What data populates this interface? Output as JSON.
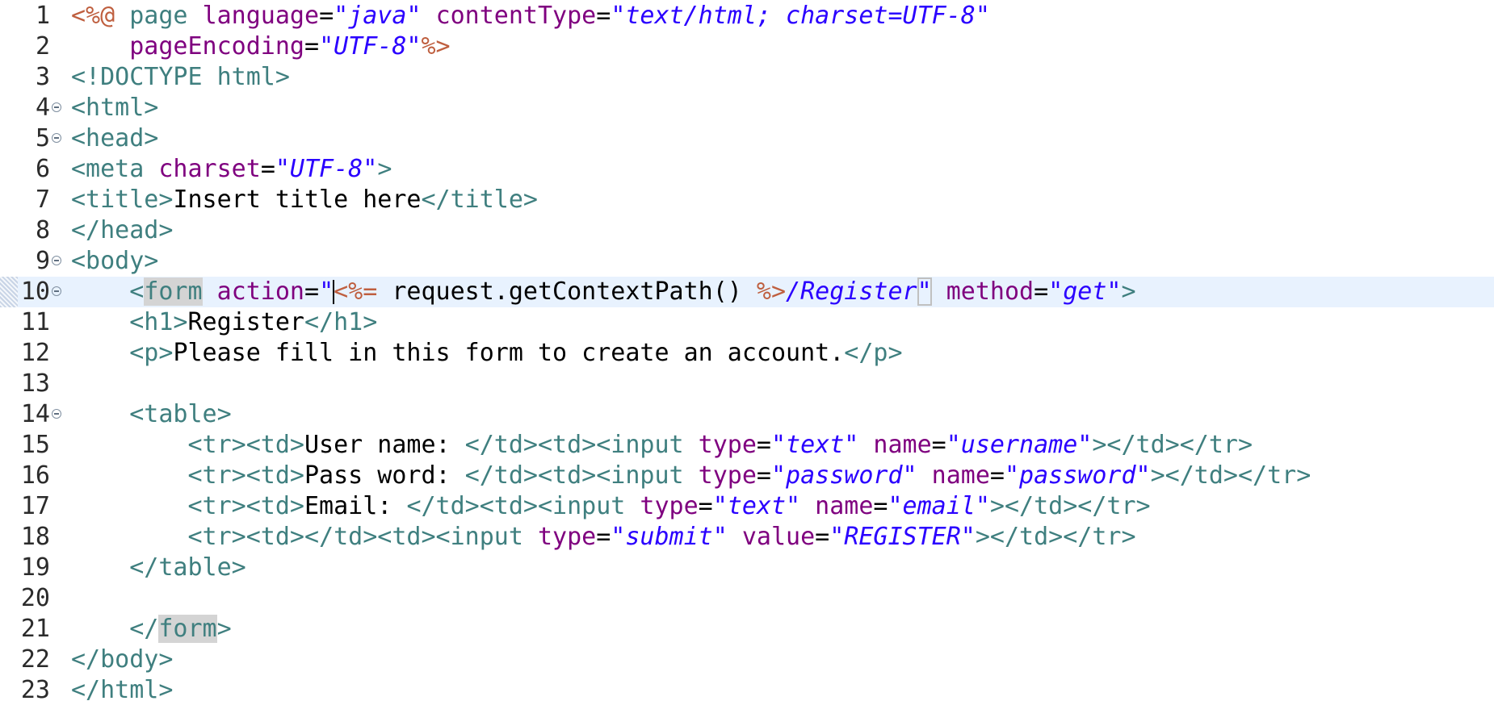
{
  "editor": {
    "current_line": 10,
    "colors": {
      "jsp_delimiter": "#bf5f3f",
      "tag": "#3f7f7f",
      "attribute": "#7f007f",
      "string": "#2a00ff",
      "text": "#000000",
      "current_line_bg": "#e8f2fe",
      "occurrence_highlight": "#d4d4d4"
    },
    "lines": [
      {
        "num": "1",
        "fold": false,
        "tokens": [
          {
            "t": "<%@",
            "k": "jsp"
          },
          {
            "t": " page ",
            "k": "tag"
          },
          {
            "t": "language",
            "k": "attr"
          },
          {
            "t": "=",
            "k": "txt"
          },
          {
            "t": "\"java\"",
            "k": "str"
          },
          {
            "t": " ",
            "k": "txt"
          },
          {
            "t": "contentType",
            "k": "attr"
          },
          {
            "t": "=",
            "k": "txt"
          },
          {
            "t": "\"text/html; charset=UTF-8\"",
            "k": "str"
          }
        ]
      },
      {
        "num": "2",
        "fold": false,
        "tokens": [
          {
            "t": "    ",
            "k": "txt"
          },
          {
            "t": "pageEncoding",
            "k": "attr"
          },
          {
            "t": "=",
            "k": "txt"
          },
          {
            "t": "\"UTF-8\"",
            "k": "str"
          },
          {
            "t": "%>",
            "k": "jsp"
          }
        ]
      },
      {
        "num": "3",
        "fold": false,
        "tokens": [
          {
            "t": "<!DOCTYPE html>",
            "k": "tag"
          }
        ]
      },
      {
        "num": "4",
        "fold": true,
        "tokens": [
          {
            "t": "<html>",
            "k": "tag"
          }
        ]
      },
      {
        "num": "5",
        "fold": true,
        "tokens": [
          {
            "t": "<head>",
            "k": "tag"
          }
        ]
      },
      {
        "num": "6",
        "fold": false,
        "tokens": [
          {
            "t": "<meta ",
            "k": "tag"
          },
          {
            "t": "charset",
            "k": "attr"
          },
          {
            "t": "=",
            "k": "txt"
          },
          {
            "t": "\"UTF-8\"",
            "k": "str"
          },
          {
            "t": ">",
            "k": "tag"
          }
        ]
      },
      {
        "num": "7",
        "fold": false,
        "tokens": [
          {
            "t": "<title>",
            "k": "tag"
          },
          {
            "t": "Insert title here",
            "k": "txt"
          },
          {
            "t": "</title>",
            "k": "tag"
          }
        ]
      },
      {
        "num": "8",
        "fold": false,
        "tokens": [
          {
            "t": "</head>",
            "k": "tag"
          }
        ]
      },
      {
        "num": "9",
        "fold": true,
        "tokens": [
          {
            "t": "<body>",
            "k": "tag"
          }
        ]
      },
      {
        "num": "10",
        "fold": true,
        "current": true,
        "tokens": [
          {
            "t": "    ",
            "k": "txt"
          },
          {
            "t": "<",
            "k": "tag"
          },
          {
            "t": "form",
            "k": "tag",
            "hl": true
          },
          {
            "t": " ",
            "k": "txt"
          },
          {
            "t": "action",
            "k": "attr"
          },
          {
            "t": "=",
            "k": "txt"
          },
          {
            "t": "\"",
            "k": "str",
            "caret": true
          },
          {
            "t": "<%=",
            "k": "jsp"
          },
          {
            "t": " request.getContextPath() ",
            "k": "txt"
          },
          {
            "t": "%>",
            "k": "jsp"
          },
          {
            "t": "/Register",
            "k": "str"
          },
          {
            "t": "\"",
            "k": "str",
            "bm": true
          },
          {
            "t": " ",
            "k": "txt"
          },
          {
            "t": "method",
            "k": "attr"
          },
          {
            "t": "=",
            "k": "txt"
          },
          {
            "t": "\"get\"",
            "k": "str"
          },
          {
            "t": ">",
            "k": "tag"
          }
        ]
      },
      {
        "num": "11",
        "fold": false,
        "tokens": [
          {
            "t": "    ",
            "k": "txt"
          },
          {
            "t": "<h1>",
            "k": "tag"
          },
          {
            "t": "Register",
            "k": "txt"
          },
          {
            "t": "</h1>",
            "k": "tag"
          }
        ]
      },
      {
        "num": "12",
        "fold": false,
        "tokens": [
          {
            "t": "    ",
            "k": "txt"
          },
          {
            "t": "<p>",
            "k": "tag"
          },
          {
            "t": "Please fill in this form to create an account.",
            "k": "txt"
          },
          {
            "t": "</p>",
            "k": "tag"
          }
        ]
      },
      {
        "num": "13",
        "fold": false,
        "tokens": []
      },
      {
        "num": "14",
        "fold": true,
        "tokens": [
          {
            "t": "    ",
            "k": "txt"
          },
          {
            "t": "<table>",
            "k": "tag"
          }
        ]
      },
      {
        "num": "15",
        "fold": false,
        "tokens": [
          {
            "t": "        ",
            "k": "txt"
          },
          {
            "t": "<tr><td>",
            "k": "tag"
          },
          {
            "t": "User name: ",
            "k": "txt"
          },
          {
            "t": "</td><td><input ",
            "k": "tag"
          },
          {
            "t": "type",
            "k": "attr"
          },
          {
            "t": "=",
            "k": "txt"
          },
          {
            "t": "\"text\"",
            "k": "str"
          },
          {
            "t": " ",
            "k": "txt"
          },
          {
            "t": "name",
            "k": "attr"
          },
          {
            "t": "=",
            "k": "txt"
          },
          {
            "t": "\"username\"",
            "k": "str"
          },
          {
            "t": "></td></tr>",
            "k": "tag"
          }
        ]
      },
      {
        "num": "16",
        "fold": false,
        "tokens": [
          {
            "t": "        ",
            "k": "txt"
          },
          {
            "t": "<tr><td>",
            "k": "tag"
          },
          {
            "t": "Pass word: ",
            "k": "txt"
          },
          {
            "t": "</td><td><input ",
            "k": "tag"
          },
          {
            "t": "type",
            "k": "attr"
          },
          {
            "t": "=",
            "k": "txt"
          },
          {
            "t": "\"password\"",
            "k": "str"
          },
          {
            "t": " ",
            "k": "txt"
          },
          {
            "t": "name",
            "k": "attr"
          },
          {
            "t": "=",
            "k": "txt"
          },
          {
            "t": "\"password\"",
            "k": "str"
          },
          {
            "t": "></td></tr>",
            "k": "tag"
          }
        ]
      },
      {
        "num": "17",
        "fold": false,
        "tokens": [
          {
            "t": "        ",
            "k": "txt"
          },
          {
            "t": "<tr><td>",
            "k": "tag"
          },
          {
            "t": "Email: ",
            "k": "txt"
          },
          {
            "t": "</td><td><input ",
            "k": "tag"
          },
          {
            "t": "type",
            "k": "attr"
          },
          {
            "t": "=",
            "k": "txt"
          },
          {
            "t": "\"text\"",
            "k": "str"
          },
          {
            "t": " ",
            "k": "txt"
          },
          {
            "t": "name",
            "k": "attr"
          },
          {
            "t": "=",
            "k": "txt"
          },
          {
            "t": "\"email\"",
            "k": "str"
          },
          {
            "t": "></td></tr>",
            "k": "tag"
          }
        ]
      },
      {
        "num": "18",
        "fold": false,
        "tokens": [
          {
            "t": "        ",
            "k": "txt"
          },
          {
            "t": "<tr><td></td><td><input ",
            "k": "tag"
          },
          {
            "t": "type",
            "k": "attr"
          },
          {
            "t": "=",
            "k": "txt"
          },
          {
            "t": "\"submit\"",
            "k": "str"
          },
          {
            "t": " ",
            "k": "txt"
          },
          {
            "t": "value",
            "k": "attr"
          },
          {
            "t": "=",
            "k": "txt"
          },
          {
            "t": "\"REGISTER\"",
            "k": "str"
          },
          {
            "t": "></td></tr>",
            "k": "tag"
          }
        ]
      },
      {
        "num": "19",
        "fold": false,
        "tokens": [
          {
            "t": "    ",
            "k": "txt"
          },
          {
            "t": "</table>",
            "k": "tag"
          }
        ]
      },
      {
        "num": "20",
        "fold": false,
        "tokens": []
      },
      {
        "num": "21",
        "fold": false,
        "tokens": [
          {
            "t": "    ",
            "k": "txt"
          },
          {
            "t": "</",
            "k": "tag"
          },
          {
            "t": "form",
            "k": "tag",
            "hl": true
          },
          {
            "t": ">",
            "k": "tag"
          }
        ]
      },
      {
        "num": "22",
        "fold": false,
        "tokens": [
          {
            "t": "</body>",
            "k": "tag"
          }
        ]
      },
      {
        "num": "23",
        "fold": false,
        "tokens": [
          {
            "t": "</html>",
            "k": "tag"
          }
        ]
      }
    ]
  }
}
